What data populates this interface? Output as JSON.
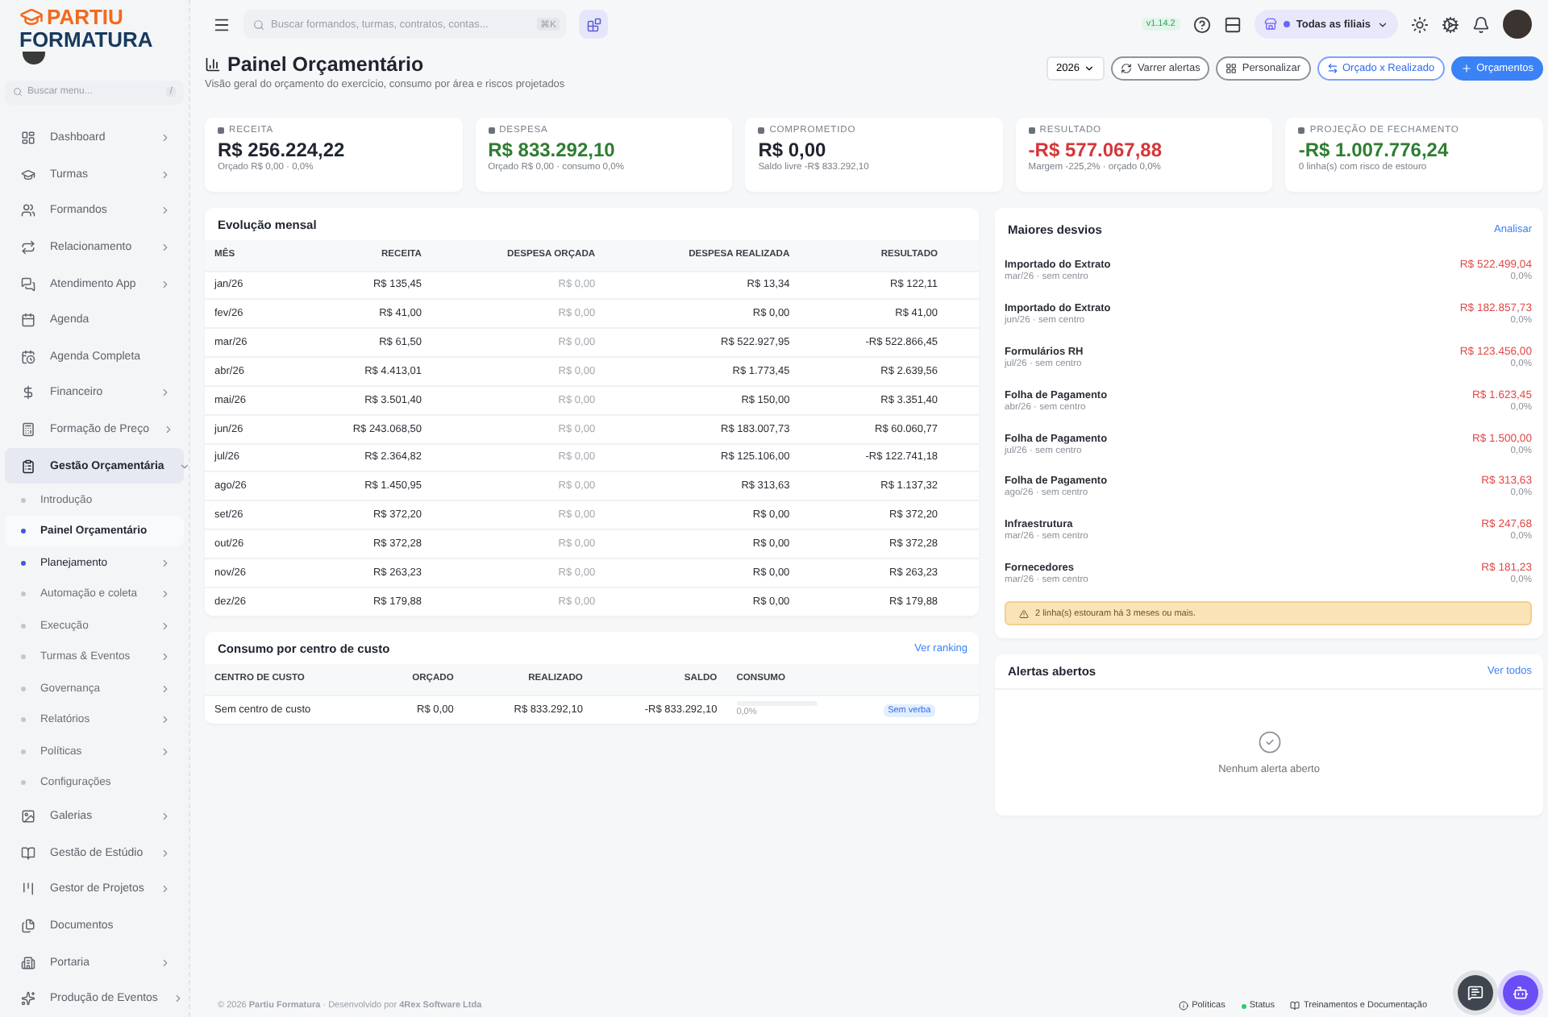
{
  "brand": {
    "word_1": "PARTIU",
    "word_2": "FORMATURA"
  },
  "sidebar": {
    "search": {
      "placeholder": "Buscar menu...",
      "shortcut": "/"
    },
    "items": [
      {
        "label": "Dashboard",
        "kind": "group",
        "expanded": false
      },
      {
        "label": "Turmas",
        "kind": "group",
        "expanded": false
      },
      {
        "label": "Formandos",
        "kind": "group",
        "expanded": false
      },
      {
        "label": "Relacionamento",
        "kind": "group",
        "expanded": false
      },
      {
        "label": "Atendimento App",
        "kind": "group",
        "expanded": false
      },
      {
        "label": "Agenda",
        "kind": "link",
        "expanded": false
      },
      {
        "label": "Agenda Completa",
        "kind": "link",
        "expanded": false
      },
      {
        "label": "Financeiro",
        "kind": "group",
        "expanded": false
      },
      {
        "label": "Formação de Preço",
        "kind": "group",
        "expanded": false
      },
      {
        "label": "Gestão Orçamentária",
        "kind": "group",
        "expanded": true,
        "children": [
          {
            "label": "Introdução",
            "kind": "link",
            "selected": false,
            "active": false
          },
          {
            "label": "Painel Orçamentário",
            "kind": "link",
            "selected": true,
            "active": true
          },
          {
            "label": "Planejamento",
            "kind": "group",
            "selected": false,
            "active": true
          },
          {
            "label": "Automação e coleta",
            "kind": "group",
            "selected": false,
            "active": false
          },
          {
            "label": "Execução",
            "kind": "group",
            "selected": false,
            "active": false
          },
          {
            "label": "Turmas & Eventos",
            "kind": "group",
            "selected": false,
            "active": false
          },
          {
            "label": "Governança",
            "kind": "group",
            "selected": false,
            "active": false
          },
          {
            "label": "Relatórios",
            "kind": "group",
            "selected": false,
            "active": false
          },
          {
            "label": "Políticas",
            "kind": "group",
            "selected": false,
            "active": false
          },
          {
            "label": "Configurações",
            "kind": "link",
            "selected": false,
            "active": false
          }
        ]
      },
      {
        "label": "Galerias",
        "kind": "group",
        "expanded": false
      },
      {
        "label": "Gestão de Estúdio",
        "kind": "group",
        "expanded": false
      },
      {
        "label": "Gestor de Projetos",
        "kind": "group",
        "expanded": false
      },
      {
        "label": "Documentos",
        "kind": "link",
        "expanded": false
      },
      {
        "label": "Portaria",
        "kind": "group",
        "expanded": false
      },
      {
        "label": "Produção de Eventos",
        "kind": "group",
        "expanded": false
      }
    ]
  },
  "topbar": {
    "search": {
      "placeholder": "Buscar formandos, turmas, contratos, contas...",
      "shortcut": "⌘K"
    },
    "version": "v1.14.2",
    "branch": "Todas as filiais"
  },
  "header": {
    "title": "Painel Orçamentário",
    "subtitle": "Visão geral do orçamento do exercício, consumo por área e riscos projetados",
    "year": "2026",
    "actions": [
      {
        "label": "Varrer alertas",
        "kind": "outline"
      },
      {
        "label": "Personalizar",
        "kind": "outline"
      },
      {
        "label": "Orçado x Realizado",
        "kind": "accent"
      },
      {
        "label": "Orçamentos",
        "kind": "primary"
      }
    ]
  },
  "kpis": [
    {
      "label": "RECEITA",
      "value": "R$ 256.224,22",
      "note": "Orçado R$ 0,00 · 0,0%",
      "color": "#1f2430"
    },
    {
      "label": "DESPESA",
      "value": "R$ 833.292,10",
      "note": "Orçado R$ 0,00 · consumo 0,0%",
      "color": "#2e7d32"
    },
    {
      "label": "COMPROMETIDO",
      "value": "R$ 0,00",
      "note": "Saldo livre -R$ 833.292,10",
      "color": "#1f2430"
    },
    {
      "label": "RESULTADO",
      "value": "-R$ 577.067,88",
      "note": "Margem -225,2% · orçado 0,0%",
      "color": "#d63638"
    },
    {
      "label": "PROJEÇÃO DE FECHAMENTO",
      "value": "-R$ 1.007.776,24",
      "note": "0 linha(s) com risco de estouro",
      "color": "#2e7d32"
    }
  ],
  "monthly": {
    "title": "Evolução mensal",
    "columns": [
      "MÊS",
      "RECEITA",
      "DESPESA ORÇADA",
      "DESPESA REALIZADA",
      "RESULTADO"
    ],
    "rows": [
      [
        "jan/26",
        "R$ 135,45",
        "R$ 0,00",
        "R$ 13,34",
        "R$ 122,11"
      ],
      [
        "fev/26",
        "R$ 41,00",
        "R$ 0,00",
        "R$ 0,00",
        "R$ 41,00"
      ],
      [
        "mar/26",
        "R$ 61,50",
        "R$ 0,00",
        "R$ 522.927,95",
        "-R$ 522.866,45"
      ],
      [
        "abr/26",
        "R$ 4.413,01",
        "R$ 0,00",
        "R$ 1.773,45",
        "R$ 2.639,56"
      ],
      [
        "mai/26",
        "R$ 3.501,40",
        "R$ 0,00",
        "R$ 150,00",
        "R$ 3.351,40"
      ],
      [
        "jun/26",
        "R$ 243.068,50",
        "R$ 0,00",
        "R$ 183.007,73",
        "R$ 60.060,77"
      ],
      [
        "jul/26",
        "R$ 2.364,82",
        "R$ 0,00",
        "R$ 125.106,00",
        "-R$ 122.741,18"
      ],
      [
        "ago/26",
        "R$ 1.450,95",
        "R$ 0,00",
        "R$ 313,63",
        "R$ 1.137,32"
      ],
      [
        "set/26",
        "R$ 372,20",
        "R$ 0,00",
        "R$ 0,00",
        "R$ 372,20"
      ],
      [
        "out/26",
        "R$ 372,28",
        "R$ 0,00",
        "R$ 0,00",
        "R$ 372,28"
      ],
      [
        "nov/26",
        "R$ 263,23",
        "R$ 0,00",
        "R$ 0,00",
        "R$ 263,23"
      ],
      [
        "dez/26",
        "R$ 179,88",
        "R$ 0,00",
        "R$ 0,00",
        "R$ 179,88"
      ]
    ]
  },
  "cost_centers": {
    "title": "Consumo por centro de custo",
    "link": "Ver ranking",
    "columns": [
      "CENTRO DE CUSTO",
      "ORÇADO",
      "REALIZADO",
      "SALDO",
      "CONSUMO"
    ],
    "rows": [
      {
        "name": "Sem centro de custo",
        "budget": "R$ 0,00",
        "actual": "R$ 833.292,10",
        "balance": "-R$ 833.292,10",
        "consumption": "0,0%",
        "level": 0,
        "badge": "Sem verba"
      }
    ]
  },
  "deviations": {
    "title": "Maiores desvios",
    "link": "Analisar",
    "items": [
      {
        "name": "Importado do Extrato",
        "detail": "mar/26 · sem centro",
        "amount": "R$ 522.499,04",
        "percent": "0,0%"
      },
      {
        "name": "Importado do Extrato",
        "detail": "jun/26 · sem centro",
        "amount": "R$ 182.857,73",
        "percent": "0,0%"
      },
      {
        "name": "Formulários RH",
        "detail": "jul/26 · sem centro",
        "amount": "R$ 123.456,00",
        "percent": "0,0%"
      },
      {
        "name": "Folha de Pagamento",
        "detail": "abr/26 · sem centro",
        "amount": "R$ 1.623,45",
        "percent": "0,0%"
      },
      {
        "name": "Folha de Pagamento",
        "detail": "jul/26 · sem centro",
        "amount": "R$ 1.500,00",
        "percent": "0,0%"
      },
      {
        "name": "Folha de Pagamento",
        "detail": "ago/26 · sem centro",
        "amount": "R$ 313,63",
        "percent": "0,0%"
      },
      {
        "name": "Infraestrutura",
        "detail": "mar/26 · sem centro",
        "amount": "R$ 247,68",
        "percent": "0,0%"
      },
      {
        "name": "Fornecedores",
        "detail": "mar/26 · sem centro",
        "amount": "R$ 181,23",
        "percent": "0,0%"
      }
    ],
    "warning": "2 linha(s) estouram há 3 meses ou mais."
  },
  "alerts": {
    "title": "Alertas abertos",
    "link": "Ver todos",
    "empty": "Nenhum alerta aberto"
  },
  "footer": {
    "copyright": "© 2026 **Partiu Formatura** · Desenvolvido por **4Rex Software Ltda**",
    "links": [
      "Políticas",
      "Status",
      "Treinamentos e Documentação"
    ]
  }
}
